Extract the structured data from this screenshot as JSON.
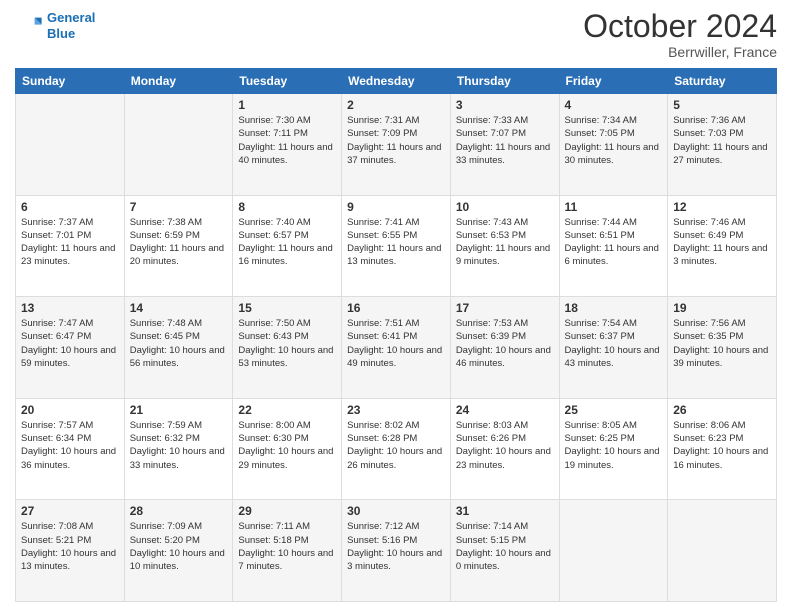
{
  "header": {
    "logo_line1": "General",
    "logo_line2": "Blue",
    "month": "October 2024",
    "location": "Berrwiller, France"
  },
  "days_of_week": [
    "Sunday",
    "Monday",
    "Tuesday",
    "Wednesday",
    "Thursday",
    "Friday",
    "Saturday"
  ],
  "weeks": [
    [
      {
        "day": "",
        "info": ""
      },
      {
        "day": "",
        "info": ""
      },
      {
        "day": "1",
        "info": "Sunrise: 7:30 AM\nSunset: 7:11 PM\nDaylight: 11 hours and 40 minutes."
      },
      {
        "day": "2",
        "info": "Sunrise: 7:31 AM\nSunset: 7:09 PM\nDaylight: 11 hours and 37 minutes."
      },
      {
        "day": "3",
        "info": "Sunrise: 7:33 AM\nSunset: 7:07 PM\nDaylight: 11 hours and 33 minutes."
      },
      {
        "day": "4",
        "info": "Sunrise: 7:34 AM\nSunset: 7:05 PM\nDaylight: 11 hours and 30 minutes."
      },
      {
        "day": "5",
        "info": "Sunrise: 7:36 AM\nSunset: 7:03 PM\nDaylight: 11 hours and 27 minutes."
      }
    ],
    [
      {
        "day": "6",
        "info": "Sunrise: 7:37 AM\nSunset: 7:01 PM\nDaylight: 11 hours and 23 minutes."
      },
      {
        "day": "7",
        "info": "Sunrise: 7:38 AM\nSunset: 6:59 PM\nDaylight: 11 hours and 20 minutes."
      },
      {
        "day": "8",
        "info": "Sunrise: 7:40 AM\nSunset: 6:57 PM\nDaylight: 11 hours and 16 minutes."
      },
      {
        "day": "9",
        "info": "Sunrise: 7:41 AM\nSunset: 6:55 PM\nDaylight: 11 hours and 13 minutes."
      },
      {
        "day": "10",
        "info": "Sunrise: 7:43 AM\nSunset: 6:53 PM\nDaylight: 11 hours and 9 minutes."
      },
      {
        "day": "11",
        "info": "Sunrise: 7:44 AM\nSunset: 6:51 PM\nDaylight: 11 hours and 6 minutes."
      },
      {
        "day": "12",
        "info": "Sunrise: 7:46 AM\nSunset: 6:49 PM\nDaylight: 11 hours and 3 minutes."
      }
    ],
    [
      {
        "day": "13",
        "info": "Sunrise: 7:47 AM\nSunset: 6:47 PM\nDaylight: 10 hours and 59 minutes."
      },
      {
        "day": "14",
        "info": "Sunrise: 7:48 AM\nSunset: 6:45 PM\nDaylight: 10 hours and 56 minutes."
      },
      {
        "day": "15",
        "info": "Sunrise: 7:50 AM\nSunset: 6:43 PM\nDaylight: 10 hours and 53 minutes."
      },
      {
        "day": "16",
        "info": "Sunrise: 7:51 AM\nSunset: 6:41 PM\nDaylight: 10 hours and 49 minutes."
      },
      {
        "day": "17",
        "info": "Sunrise: 7:53 AM\nSunset: 6:39 PM\nDaylight: 10 hours and 46 minutes."
      },
      {
        "day": "18",
        "info": "Sunrise: 7:54 AM\nSunset: 6:37 PM\nDaylight: 10 hours and 43 minutes."
      },
      {
        "day": "19",
        "info": "Sunrise: 7:56 AM\nSunset: 6:35 PM\nDaylight: 10 hours and 39 minutes."
      }
    ],
    [
      {
        "day": "20",
        "info": "Sunrise: 7:57 AM\nSunset: 6:34 PM\nDaylight: 10 hours and 36 minutes."
      },
      {
        "day": "21",
        "info": "Sunrise: 7:59 AM\nSunset: 6:32 PM\nDaylight: 10 hours and 33 minutes."
      },
      {
        "day": "22",
        "info": "Sunrise: 8:00 AM\nSunset: 6:30 PM\nDaylight: 10 hours and 29 minutes."
      },
      {
        "day": "23",
        "info": "Sunrise: 8:02 AM\nSunset: 6:28 PM\nDaylight: 10 hours and 26 minutes."
      },
      {
        "day": "24",
        "info": "Sunrise: 8:03 AM\nSunset: 6:26 PM\nDaylight: 10 hours and 23 minutes."
      },
      {
        "day": "25",
        "info": "Sunrise: 8:05 AM\nSunset: 6:25 PM\nDaylight: 10 hours and 19 minutes."
      },
      {
        "day": "26",
        "info": "Sunrise: 8:06 AM\nSunset: 6:23 PM\nDaylight: 10 hours and 16 minutes."
      }
    ],
    [
      {
        "day": "27",
        "info": "Sunrise: 7:08 AM\nSunset: 5:21 PM\nDaylight: 10 hours and 13 minutes."
      },
      {
        "day": "28",
        "info": "Sunrise: 7:09 AM\nSunset: 5:20 PM\nDaylight: 10 hours and 10 minutes."
      },
      {
        "day": "29",
        "info": "Sunrise: 7:11 AM\nSunset: 5:18 PM\nDaylight: 10 hours and 7 minutes."
      },
      {
        "day": "30",
        "info": "Sunrise: 7:12 AM\nSunset: 5:16 PM\nDaylight: 10 hours and 3 minutes."
      },
      {
        "day": "31",
        "info": "Sunrise: 7:14 AM\nSunset: 5:15 PM\nDaylight: 10 hours and 0 minutes."
      },
      {
        "day": "",
        "info": ""
      },
      {
        "day": "",
        "info": ""
      }
    ]
  ]
}
